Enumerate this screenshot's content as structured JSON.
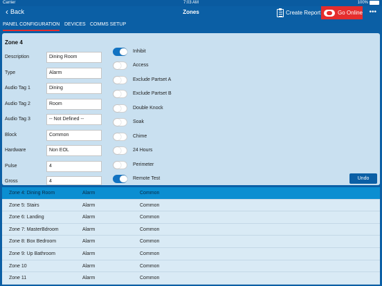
{
  "status_bar": {
    "carrier": "Carrier",
    "time": "7:03 AM",
    "battery": "100%"
  },
  "nav": {
    "back_label": "Back",
    "title": "Zones",
    "create_report_label": "Create Report",
    "go_online_label": "Go Online",
    "more_label": "•••"
  },
  "tabs": [
    "PANEL CONFIGURATION",
    "DEVICES",
    "COMMS SETUP"
  ],
  "zone": {
    "title": "Zone 4",
    "fields": [
      {
        "label": "Description",
        "value": "Dining Room"
      },
      {
        "label": "Type",
        "value": "Alarm"
      },
      {
        "label": "Audio Tag 1",
        "value": "Dining"
      },
      {
        "label": "Audio Tag 2",
        "value": "Room"
      },
      {
        "label": "Audio Tag 3",
        "value": "-- Not Defined --"
      },
      {
        "label": "Block",
        "value": "Common"
      },
      {
        "label": "Hardware",
        "value": "Non EOL"
      },
      {
        "label": "Pulse",
        "value": "4"
      },
      {
        "label": "Gross",
        "value": "4"
      }
    ],
    "toggles": [
      {
        "label": "Inhibit",
        "on": true
      },
      {
        "label": "Access",
        "on": false
      },
      {
        "label": "Exclude Partset A",
        "on": false
      },
      {
        "label": "Exclude Partset B",
        "on": false
      },
      {
        "label": "Double Knock",
        "on": false
      },
      {
        "label": "Soak",
        "on": false
      },
      {
        "label": "Chime",
        "on": false
      },
      {
        "label": "24 Hours",
        "on": false
      },
      {
        "label": "Perimeter",
        "on": false
      },
      {
        "label": "Remote Test",
        "on": true
      }
    ],
    "undo_label": "Undo"
  },
  "zone_list": [
    {
      "name": "Zone 4: Dining Room",
      "type": "Alarm",
      "block": "Common",
      "selected": true
    },
    {
      "name": "Zone 5: Stairs",
      "type": "Alarm",
      "block": "Common"
    },
    {
      "name": "Zone 6: Landing",
      "type": "Alarm",
      "block": "Common"
    },
    {
      "name": "Zone 7: MasterBdroom",
      "type": "Alarm",
      "block": "Common"
    },
    {
      "name": "Zone 8: Box Bedroom",
      "type": "Alarm",
      "block": "Common"
    },
    {
      "name": "Zone 9: Up Bathroom",
      "type": "Alarm",
      "block": "Common"
    },
    {
      "name": "Zone 10",
      "type": "Alarm",
      "block": "Common"
    },
    {
      "name": "Zone 11",
      "type": "Alarm",
      "block": "Common"
    }
  ],
  "colors": {
    "brand_blue": "#0b5fa5",
    "accent_red": "#e52d2d",
    "toggle_on": "#1273c2",
    "selected_row": "#0b8ed1"
  }
}
